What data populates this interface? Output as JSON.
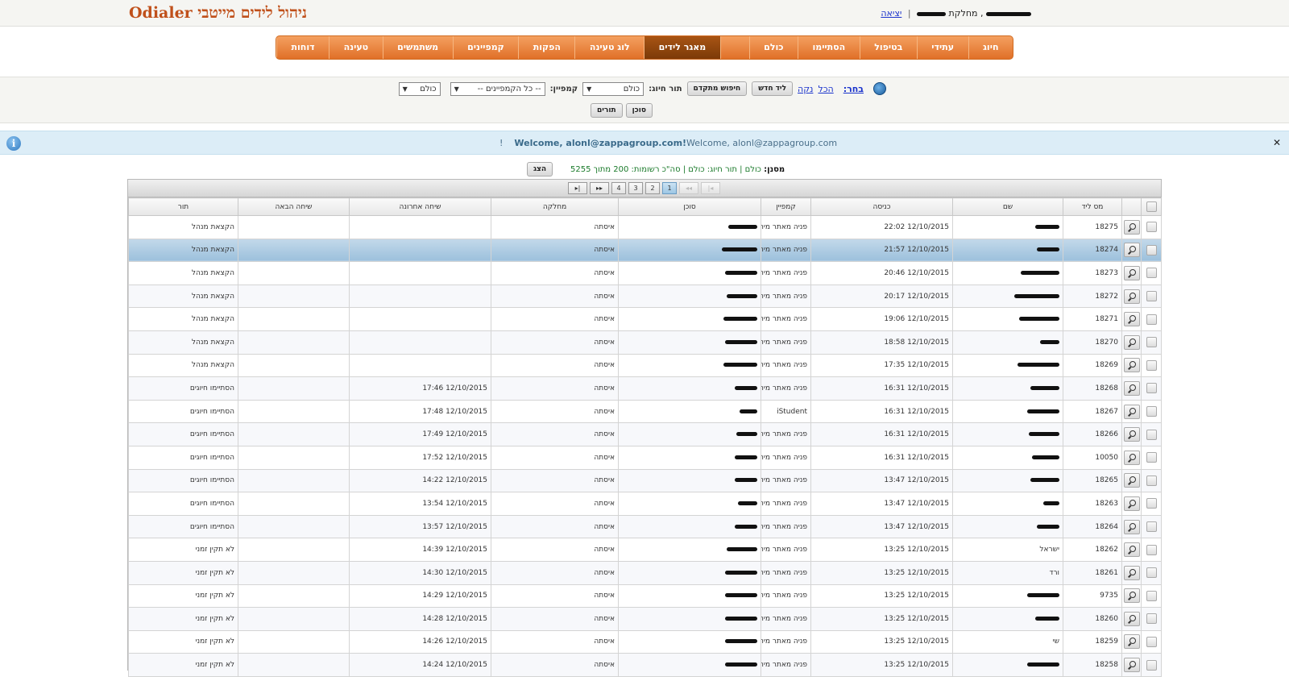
{
  "app": {
    "title": "Odialer ניהול לידים מייטבי"
  },
  "user": {
    "department_label": "מחלקת",
    "logout_label": "יציאה"
  },
  "menu": {
    "items": [
      {
        "label": "חיוג",
        "active": false
      },
      {
        "label": "עתידי",
        "active": false
      },
      {
        "label": "בטיפול",
        "active": false
      },
      {
        "label": "הסתיימו",
        "active": false
      },
      {
        "label": "כולם",
        "active": false
      },
      {
        "label": "",
        "active": false
      },
      {
        "label": "מאגר לידים",
        "active": true
      },
      {
        "label": "לוג טעינה",
        "active": false
      },
      {
        "label": "הפקות",
        "active": false
      },
      {
        "label": "קמפיינים",
        "active": false
      },
      {
        "label": "משתמשים",
        "active": false
      },
      {
        "label": "טעינה",
        "active": false
      },
      {
        "label": "דוחות",
        "active": false
      }
    ]
  },
  "filters": {
    "choose_label": "בחר:",
    "all_link": "הכל",
    "clear_link": "נקה",
    "new_lead_button": "ליד חדש",
    "advanced_search_button": "חיפוש מתקדם",
    "dial_queue_label": "תור חיוג:",
    "dial_queue_value": "כולם",
    "campaign_label": "קמפיין:",
    "campaign_value": "-- כל הקמפיינים --",
    "third_select_value": "כולם",
    "agent_button": "סוכן",
    "queues_button": "תורים"
  },
  "banner": {
    "bold_text": "Welcome, alonl@zappagroup.com!",
    "text": "Welcome, alonl@zappagroup.com",
    "bang": "!"
  },
  "status": {
    "filter_label": "מסנן:",
    "filter_text": "כולם | תור חיוג: כולם | סה\"כ רשומות: 200 מתוך 5255",
    "show_button": "הצג"
  },
  "pager": {
    "first": "|◂",
    "prev": "◂◂",
    "pages": [
      "1",
      "2",
      "3",
      "4"
    ],
    "active_page": "1",
    "next": "▸▸",
    "last": "▸|"
  },
  "table": {
    "columns": [
      "מס ליד",
      "שם",
      "כניסה",
      "קמפיין",
      "סוכן",
      "מחלקה",
      "שיחה אחרונה",
      "שיחה הבאה",
      "תור"
    ],
    "rows": [
      {
        "id": "18275",
        "name": "",
        "entry": "12/10/2015 22:02",
        "campaign": "פניה מאתר מיתוק",
        "dept": "איסתה",
        "last_call": "",
        "next_call": "",
        "queue": "הקצאת מנהל",
        "redact_name": 30,
        "redact_agent": 36
      },
      {
        "id": "18274",
        "name": "",
        "entry": "12/10/2015 21:57",
        "campaign": "פניה מאתר מיתוק",
        "dept": "איסתה",
        "last_call": "",
        "next_call": "",
        "queue": "הקצאת מנהל",
        "redact_name": 28,
        "redact_agent": 44
      },
      {
        "id": "18273",
        "name": "",
        "entry": "12/10/2015 20:46",
        "campaign": "פניה מאתר מיתוק",
        "dept": "איסתה",
        "last_call": "",
        "next_call": "",
        "queue": "הקצאת מנהל",
        "redact_name": 48,
        "redact_agent": 40
      },
      {
        "id": "18272",
        "name": "",
        "entry": "12/10/2015 20:17",
        "campaign": "פניה מאתר מיתוק",
        "dept": "איסתה",
        "last_call": "",
        "next_call": "",
        "queue": "הקצאת מנהל",
        "redact_name": 56,
        "redact_agent": 38
      },
      {
        "id": "18271",
        "name": "",
        "entry": "12/10/2015 19:06",
        "campaign": "פניה מאתר מיתוק",
        "dept": "איסתה",
        "last_call": "",
        "next_call": "",
        "queue": "הקצאת מנהל",
        "redact_name": 50,
        "redact_agent": 42
      },
      {
        "id": "18270",
        "name": "",
        "entry": "12/10/2015 18:58",
        "campaign": "פניה מאתר מיתוק",
        "dept": "איסתה",
        "last_call": "",
        "next_call": "",
        "queue": "הקצאת מנהל",
        "redact_name": 24,
        "redact_agent": 40
      },
      {
        "id": "18269",
        "name": "",
        "entry": "12/10/2015 17:35",
        "campaign": "פניה מאתר מיתוק",
        "dept": "איסתה",
        "last_call": "",
        "next_call": "",
        "queue": "הקצאת מנהל",
        "redact_name": 52,
        "redact_agent": 42
      },
      {
        "id": "18268",
        "name": "",
        "entry": "12/10/2015 16:31",
        "campaign": "פניה מאתר מיתוק",
        "dept": "איסתה",
        "last_call": "12/10/2015 17:46",
        "next_call": "",
        "queue": "הסתיימו חיוגים",
        "redact_name": 36,
        "redact_agent": 28
      },
      {
        "id": "18267",
        "name": "",
        "entry": "12/10/2015 16:31",
        "campaign": "iStudent",
        "dept": "איסתה",
        "last_call": "12/10/2015 17:48",
        "next_call": "",
        "queue": "הסתיימו חיוגים",
        "redact_name": 40,
        "redact_agent": 22
      },
      {
        "id": "18266",
        "name": "",
        "entry": "12/10/2015 16:31",
        "campaign": "פניה מאתר מיתוק",
        "dept": "איסתה",
        "last_call": "12/10/2015 17:49",
        "next_call": "",
        "queue": "הסתיימו חיוגים",
        "redact_name": 38,
        "redact_agent": 26
      },
      {
        "id": "10050",
        "name": "",
        "entry": "12/10/2015 16:31",
        "campaign": "פניה מאתר מיתוק",
        "dept": "איסתה",
        "last_call": "12/10/2015 17:52",
        "next_call": "",
        "queue": "הסתיימו חיוגים",
        "redact_name": 34,
        "redact_agent": 28
      },
      {
        "id": "18265",
        "name": "",
        "entry": "12/10/2015 13:47",
        "campaign": "פניה מאתר מיתוק",
        "dept": "איסתה",
        "last_call": "12/10/2015 14:22",
        "next_call": "",
        "queue": "הסתיימו חיוגים",
        "redact_name": 36,
        "redact_agent": 28
      },
      {
        "id": "18263",
        "name": "",
        "entry": "12/10/2015 13:47",
        "campaign": "פניה מאתר מיתוק",
        "dept": "איסתה",
        "last_call": "12/10/2015 13:54",
        "next_call": "",
        "queue": "הסתיימו חיוגים",
        "redact_name": 20,
        "redact_agent": 24
      },
      {
        "id": "18264",
        "name": "",
        "entry": "12/10/2015 13:47",
        "campaign": "פניה מאתר מיתוק",
        "dept": "איסתה",
        "last_call": "12/10/2015 13:57",
        "next_call": "",
        "queue": "הסתיימו חיוגים",
        "redact_name": 28,
        "redact_agent": 28
      },
      {
        "id": "18262",
        "name": "ישראל",
        "entry": "12/10/2015 13:25",
        "campaign": "פניה מאתר מיתוק",
        "dept": "איסתה",
        "last_call": "12/10/2015 14:39",
        "next_call": "",
        "queue": "לא תקין זמני",
        "redact_name": 0,
        "redact_agent": 38
      },
      {
        "id": "18261",
        "name": "ורד",
        "entry": "12/10/2015 13:25",
        "campaign": "פניה מאתר מיתוק",
        "dept": "איסתה",
        "last_call": "12/10/2015 14:30",
        "next_call": "",
        "queue": "לא תקין זמני",
        "redact_name": 0,
        "redact_agent": 40
      },
      {
        "id": "9735",
        "name": "",
        "entry": "12/10/2015 13:25",
        "campaign": "פניה מאתר מיתוק",
        "dept": "איסתה",
        "last_call": "12/10/2015 14:29",
        "next_call": "",
        "queue": "לא תקין זמני",
        "redact_name": 40,
        "redact_agent": 40
      },
      {
        "id": "18260",
        "name": "",
        "entry": "12/10/2015 13:25",
        "campaign": "פניה מאתר מיתוק",
        "dept": "איסתה",
        "last_call": "12/10/2015 14:28",
        "next_call": "",
        "queue": "לא תקין זמני",
        "redact_name": 30,
        "redact_agent": 40
      },
      {
        "id": "18259",
        "name": "שי",
        "entry": "12/10/2015 13:25",
        "campaign": "פניה מאתר מיתוק",
        "dept": "איסתה",
        "last_call": "12/10/2015 14:26",
        "next_call": "",
        "queue": "לא תקין זמני",
        "redact_name": 0,
        "redact_agent": 40
      },
      {
        "id": "18258",
        "name": "",
        "entry": "12/10/2015 13:25",
        "campaign": "פניה מאתר מיתוק",
        "dept": "איסתה",
        "last_call": "12/10/2015 14:24",
        "next_call": "",
        "queue": "לא תקין זמני",
        "redact_name": 40,
        "redact_agent": 40
      }
    ]
  }
}
